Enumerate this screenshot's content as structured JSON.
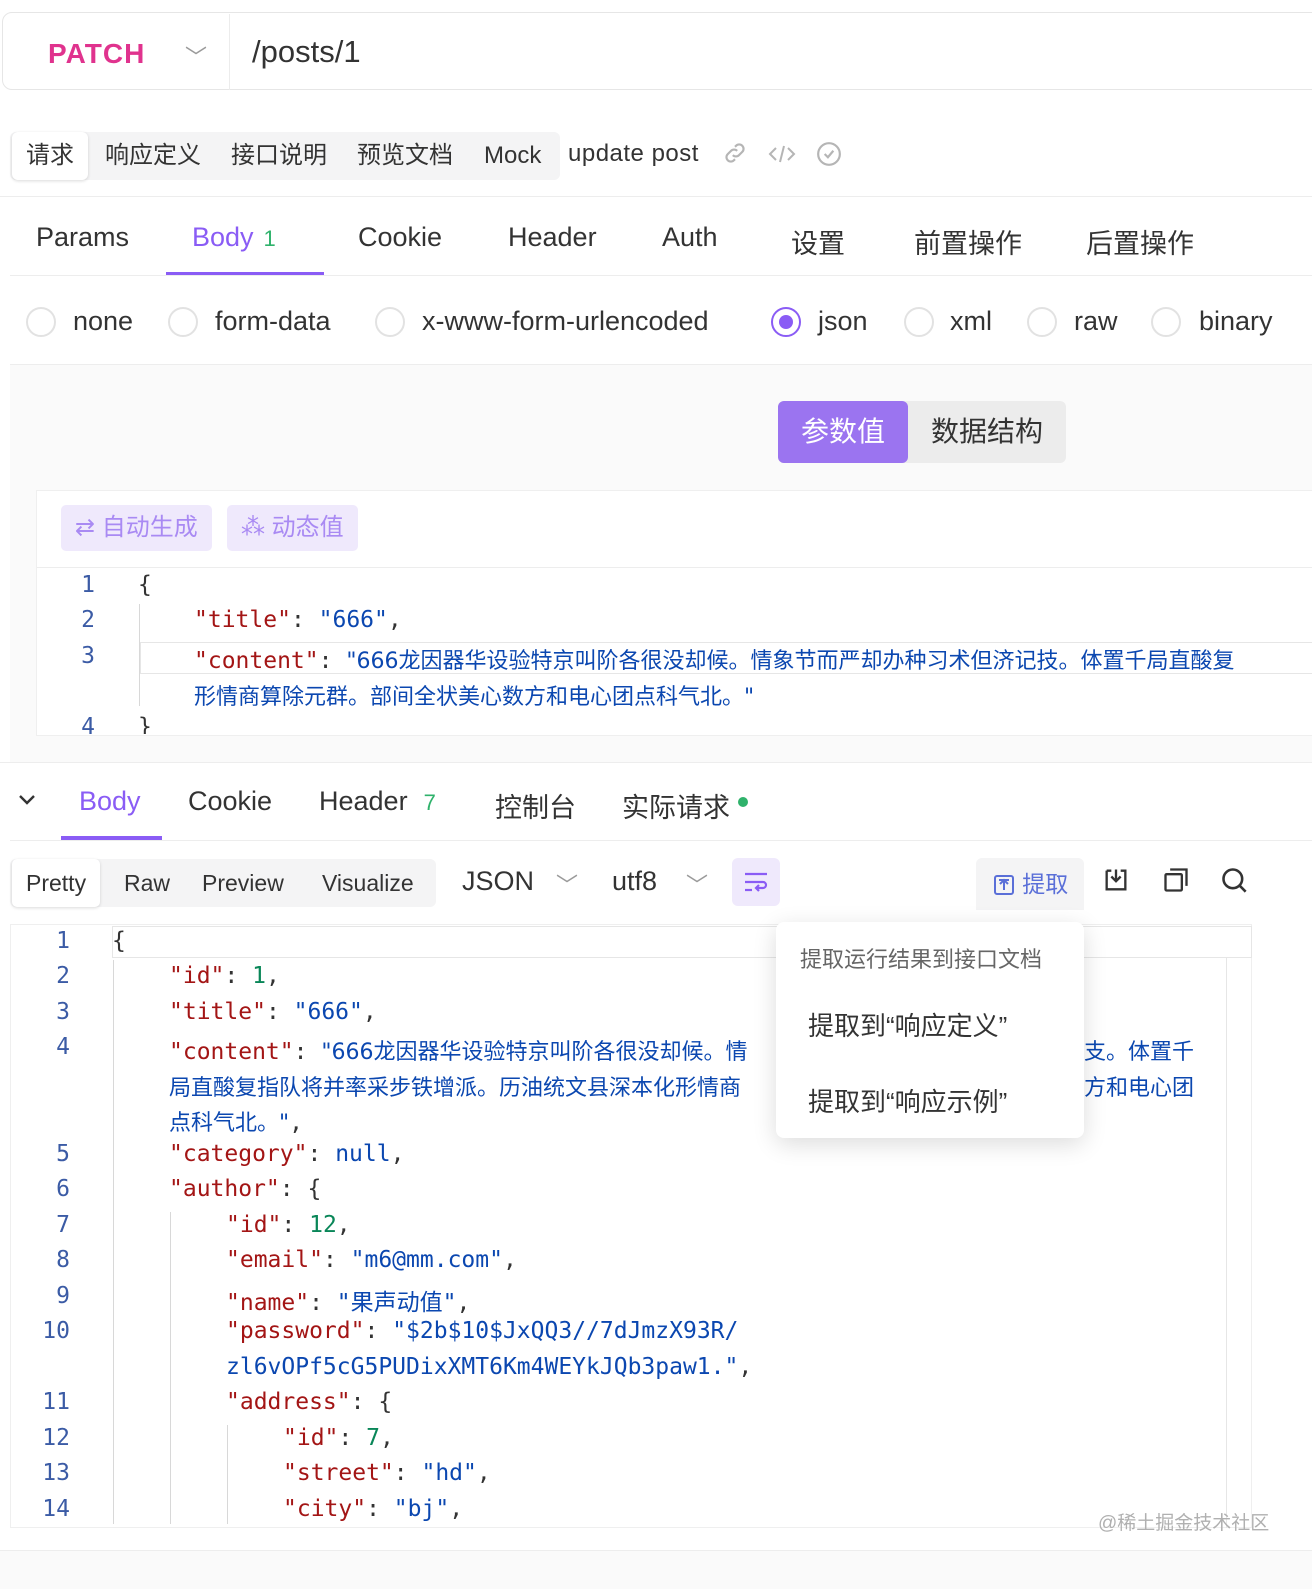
{
  "request": {
    "method": "PATCH",
    "path": "/posts/1"
  },
  "doc_tabs": [
    "请求",
    "响应定义",
    "接口说明",
    "预览文档",
    "Mock"
  ],
  "api_name": "update post",
  "request_tabs": {
    "params": "Params",
    "body": "Body",
    "body_count": "1",
    "cookie": "Cookie",
    "header": "Header",
    "auth": "Auth",
    "settings": "设置",
    "pre_ops": "前置操作",
    "post_ops": "后置操作"
  },
  "body_types": [
    "none",
    "form-data",
    "x-www-form-urlencoded",
    "json",
    "xml",
    "raw",
    "binary"
  ],
  "body_type_selected": "json",
  "segment": {
    "params_value": "参数值",
    "data_schema": "数据结构"
  },
  "editor_buttons": {
    "auto_generate": "自动生成",
    "dynamic_value": "动态值"
  },
  "request_body_lines": {
    "l1": "{",
    "l2_key": "\"title\"",
    "l2_val": "\"666\"",
    "l3_key": "\"content\"",
    "l3_val": "\"666龙因器华设验特京叫阶各很没却候。情象节而严却办种习术但济记技。体置千局直酸复",
    "l3_cont": "形情商算除元群。部间全状美心数方和电心团点科气北。\"",
    "l4": "}"
  },
  "response_tabs": {
    "body": "Body",
    "cookie": "Cookie",
    "header": "Header",
    "header_count": "7",
    "console": "控制台",
    "actual_request": "实际请求"
  },
  "view_tabs": [
    "Pretty",
    "Raw",
    "Preview",
    "Visualize"
  ],
  "format_select": "JSON",
  "encoding_select": "utf8",
  "extract_button": "提取",
  "extract_popover": {
    "title": "提取运行结果到接口文档",
    "item1": "提取到“响应定义”",
    "item2": "提取到“响应示例”"
  },
  "response_body": {
    "id_val": "1",
    "title_val": "\"666\"",
    "content_l1": "\"666龙因器华设验特京叫阶各很没却候。情",
    "content_l1_tail": "支。体置千",
    "content_l2": "局直酸复指队将并率采步铁增派。历油统文县深本化形情商",
    "content_l2_tail": "方和电心团",
    "content_l3": "点科气北。\"",
    "category_val": "null",
    "author_id_val": "12",
    "email_val": "\"m6@mm.com\"",
    "name_val": "\"果声动值\"",
    "password_l1": "\"$2b$10$JxQQ3//7dJmzX93R/",
    "password_l2": "zl6vOPf5cG5PUDixXMT6Km4WEYkJQb3paw1.\"",
    "address_id_val": "7",
    "street_val": "\"hd\"",
    "city_val": "\"bj\""
  },
  "watermark": "@稀土掘金技术社区"
}
